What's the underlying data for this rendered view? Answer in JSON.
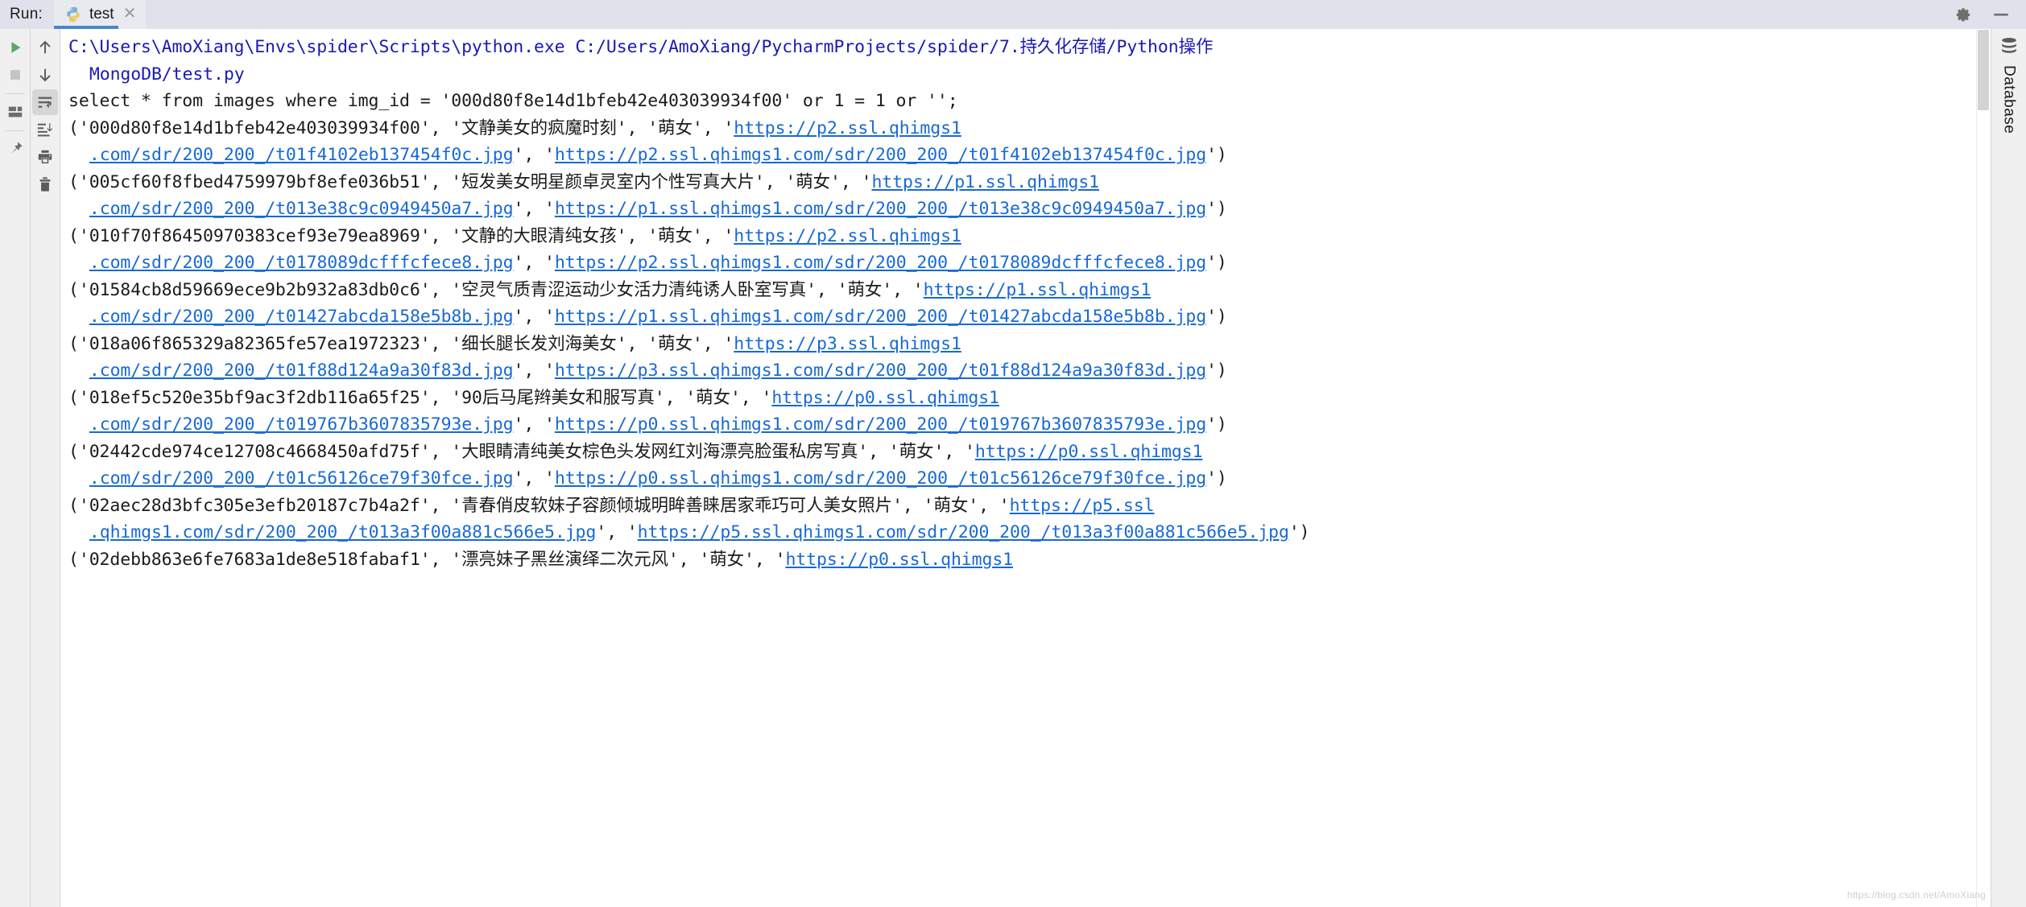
{
  "window": {
    "run_label": "Run:",
    "settings_icon": "gear-icon",
    "minimize_icon": "minimize-icon"
  },
  "tab": {
    "title": "test",
    "icon": "python-file-icon",
    "close_icon": "close-icon"
  },
  "left_toolbar": {
    "column1": [
      {
        "name": "rerun-button",
        "icon": "play-icon"
      },
      {
        "name": "stop-button",
        "icon": "stop-square-icon"
      },
      {
        "name": "separator-1",
        "icon": "separator"
      },
      {
        "name": "layout-button",
        "icon": "layout-panels-icon"
      },
      {
        "name": "separator-2",
        "icon": "separator"
      },
      {
        "name": "pin-tab-button",
        "icon": "pin-icon"
      }
    ],
    "column2": [
      {
        "name": "up-the-stack-button",
        "icon": "arrow-up-icon"
      },
      {
        "name": "down-the-stack-button",
        "icon": "arrow-down-icon"
      },
      {
        "name": "soft-wrap-button",
        "icon": "soft-wrap-icon",
        "pressed": true
      },
      {
        "name": "scroll-to-end-button",
        "icon": "scroll-to-end-icon"
      },
      {
        "name": "print-button",
        "icon": "printer-icon"
      },
      {
        "name": "clear-all-button",
        "icon": "trash-icon"
      }
    ]
  },
  "right_strip": {
    "label": "Database",
    "icon": "database-icon"
  },
  "watermark": "https://blog.csdn.net/AmoXiang",
  "console": {
    "lines": [
      {
        "indent": 0,
        "segments": [
          {
            "type": "cmd",
            "text": "C:\\Users\\AmoXiang\\Envs\\spider\\Scripts\\python.exe C:/Users/AmoXiang/PycharmProjects/spider/7.持久化存储/Python操作"
          }
        ]
      },
      {
        "indent": 1,
        "segments": [
          {
            "type": "cmd",
            "text": "MongoDB/test.py"
          }
        ]
      },
      {
        "indent": 0,
        "segments": [
          {
            "type": "plain",
            "text": "select * from images where img_id = '000d80f8e14d1bfeb42e403039934f00' or 1 = 1 or '';"
          }
        ]
      },
      {
        "indent": 0,
        "segments": [
          {
            "type": "plain",
            "text": "('000d80f8e14d1bfeb42e403039934f00', '文静美女的疯魔时刻', '萌女', '"
          },
          {
            "type": "link",
            "text": "https://p2.ssl.qhimgs1"
          }
        ]
      },
      {
        "indent": 1,
        "segments": [
          {
            "type": "link",
            "text": ".com/sdr/200_200_/t01f4102eb137454f0c.jpg"
          },
          {
            "type": "plain",
            "text": "', '"
          },
          {
            "type": "link",
            "text": "https://p2.ssl.qhimgs1.com/sdr/200_200_/t01f4102eb137454f0c.jpg"
          },
          {
            "type": "plain",
            "text": "')"
          }
        ]
      },
      {
        "indent": 0,
        "segments": [
          {
            "type": "plain",
            "text": "('005cf60f8fbed4759979bf8efe036b51', '短发美女明星颜卓灵室内个性写真大片', '萌女', '"
          },
          {
            "type": "link",
            "text": "https://p1.ssl.qhimgs1"
          }
        ]
      },
      {
        "indent": 1,
        "segments": [
          {
            "type": "link",
            "text": ".com/sdr/200_200_/t013e38c9c0949450a7.jpg"
          },
          {
            "type": "plain",
            "text": "', '"
          },
          {
            "type": "link",
            "text": "https://p1.ssl.qhimgs1.com/sdr/200_200_/t013e38c9c0949450a7.jpg"
          },
          {
            "type": "plain",
            "text": "')"
          }
        ]
      },
      {
        "indent": 0,
        "segments": [
          {
            "type": "plain",
            "text": "('010f70f86450970383cef93e79ea8969', '文静的大眼清纯女孩', '萌女', '"
          },
          {
            "type": "link",
            "text": "https://p2.ssl.qhimgs1"
          }
        ]
      },
      {
        "indent": 1,
        "segments": [
          {
            "type": "link",
            "text": ".com/sdr/200_200_/t0178089dcfffcfece8.jpg"
          },
          {
            "type": "plain",
            "text": "', '"
          },
          {
            "type": "link",
            "text": "https://p2.ssl.qhimgs1.com/sdr/200_200_/t0178089dcfffcfece8.jpg"
          },
          {
            "type": "plain",
            "text": "')"
          }
        ]
      },
      {
        "indent": 0,
        "segments": [
          {
            "type": "plain",
            "text": "('01584cb8d59669ece9b2b932a83db0c6', '空灵气质青涩运动少女活力清纯诱人卧室写真', '萌女', '"
          },
          {
            "type": "link",
            "text": "https://p1.ssl.qhimgs1"
          }
        ]
      },
      {
        "indent": 1,
        "segments": [
          {
            "type": "link",
            "text": ".com/sdr/200_200_/t01427abcda158e5b8b.jpg"
          },
          {
            "type": "plain",
            "text": "', '"
          },
          {
            "type": "link",
            "text": "https://p1.ssl.qhimgs1.com/sdr/200_200_/t01427abcda158e5b8b.jpg"
          },
          {
            "type": "plain",
            "text": "')"
          }
        ]
      },
      {
        "indent": 0,
        "segments": [
          {
            "type": "plain",
            "text": "('018a06f865329a82365fe57ea1972323', '细长腿长发刘海美女', '萌女', '"
          },
          {
            "type": "link",
            "text": "https://p3.ssl.qhimgs1"
          }
        ]
      },
      {
        "indent": 1,
        "segments": [
          {
            "type": "link",
            "text": ".com/sdr/200_200_/t01f88d124a9a30f83d.jpg"
          },
          {
            "type": "plain",
            "text": "', '"
          },
          {
            "type": "link",
            "text": "https://p3.ssl.qhimgs1.com/sdr/200_200_/t01f88d124a9a30f83d.jpg"
          },
          {
            "type": "plain",
            "text": "')"
          }
        ]
      },
      {
        "indent": 0,
        "segments": [
          {
            "type": "plain",
            "text": "('018ef5c520e35bf9ac3f2db116a65f25', '90后马尾辫美女和服写真', '萌女', '"
          },
          {
            "type": "link",
            "text": "https://p0.ssl.qhimgs1"
          }
        ]
      },
      {
        "indent": 1,
        "segments": [
          {
            "type": "link",
            "text": ".com/sdr/200_200_/t019767b3607835793e.jpg"
          },
          {
            "type": "plain",
            "text": "', '"
          },
          {
            "type": "link",
            "text": "https://p0.ssl.qhimgs1.com/sdr/200_200_/t019767b3607835793e.jpg"
          },
          {
            "type": "plain",
            "text": "')"
          }
        ]
      },
      {
        "indent": 0,
        "segments": [
          {
            "type": "plain",
            "text": "('02442cde974ce12708c4668450afd75f', '大眼睛清纯美女棕色头发网红刘海漂亮脸蛋私房写真', '萌女', '"
          },
          {
            "type": "link",
            "text": "https://p0.ssl.qhimgs1"
          }
        ]
      },
      {
        "indent": 1,
        "segments": [
          {
            "type": "link",
            "text": ".com/sdr/200_200_/t01c56126ce79f30fce.jpg"
          },
          {
            "type": "plain",
            "text": "', '"
          },
          {
            "type": "link",
            "text": "https://p0.ssl.qhimgs1.com/sdr/200_200_/t01c56126ce79f30fce.jpg"
          },
          {
            "type": "plain",
            "text": "')"
          }
        ]
      },
      {
        "indent": 0,
        "segments": [
          {
            "type": "plain",
            "text": "('02aec28d3bfc305e3efb20187c7b4a2f', '青春俏皮软妹子容颜倾城明眸善睐居家乖巧可人美女照片', '萌女', '"
          },
          {
            "type": "link",
            "text": "https://p5.ssl"
          }
        ]
      },
      {
        "indent": 1,
        "segments": [
          {
            "type": "link",
            "text": ".qhimgs1.com/sdr/200_200_/t013a3f00a881c566e5.jpg"
          },
          {
            "type": "plain",
            "text": "', '"
          },
          {
            "type": "link",
            "text": "https://p5.ssl.qhimgs1.com/sdr/200_200_/t013a3f00a881c566e5.jpg"
          },
          {
            "type": "plain",
            "text": "')"
          }
        ]
      },
      {
        "indent": 0,
        "segments": [
          {
            "type": "plain",
            "text": "('02debb863e6fe7683a1de8e518fabaf1', '漂亮妹子黑丝演绎二次元风', '萌女', '"
          },
          {
            "type": "link",
            "text": "https://p0.ssl.qhimgs1"
          }
        ]
      }
    ]
  },
  "colors": {
    "command_text": "#1a1ab4",
    "plain_text": "#1b1b1b",
    "link_text": "#1769d6",
    "tab_underline": "#4a86c8",
    "run_icon_green": "#59a869",
    "toolbar_bg": "#f0f0f0",
    "tabbar_bg": "#dfe2ea",
    "console_bg": "#ffffff"
  }
}
